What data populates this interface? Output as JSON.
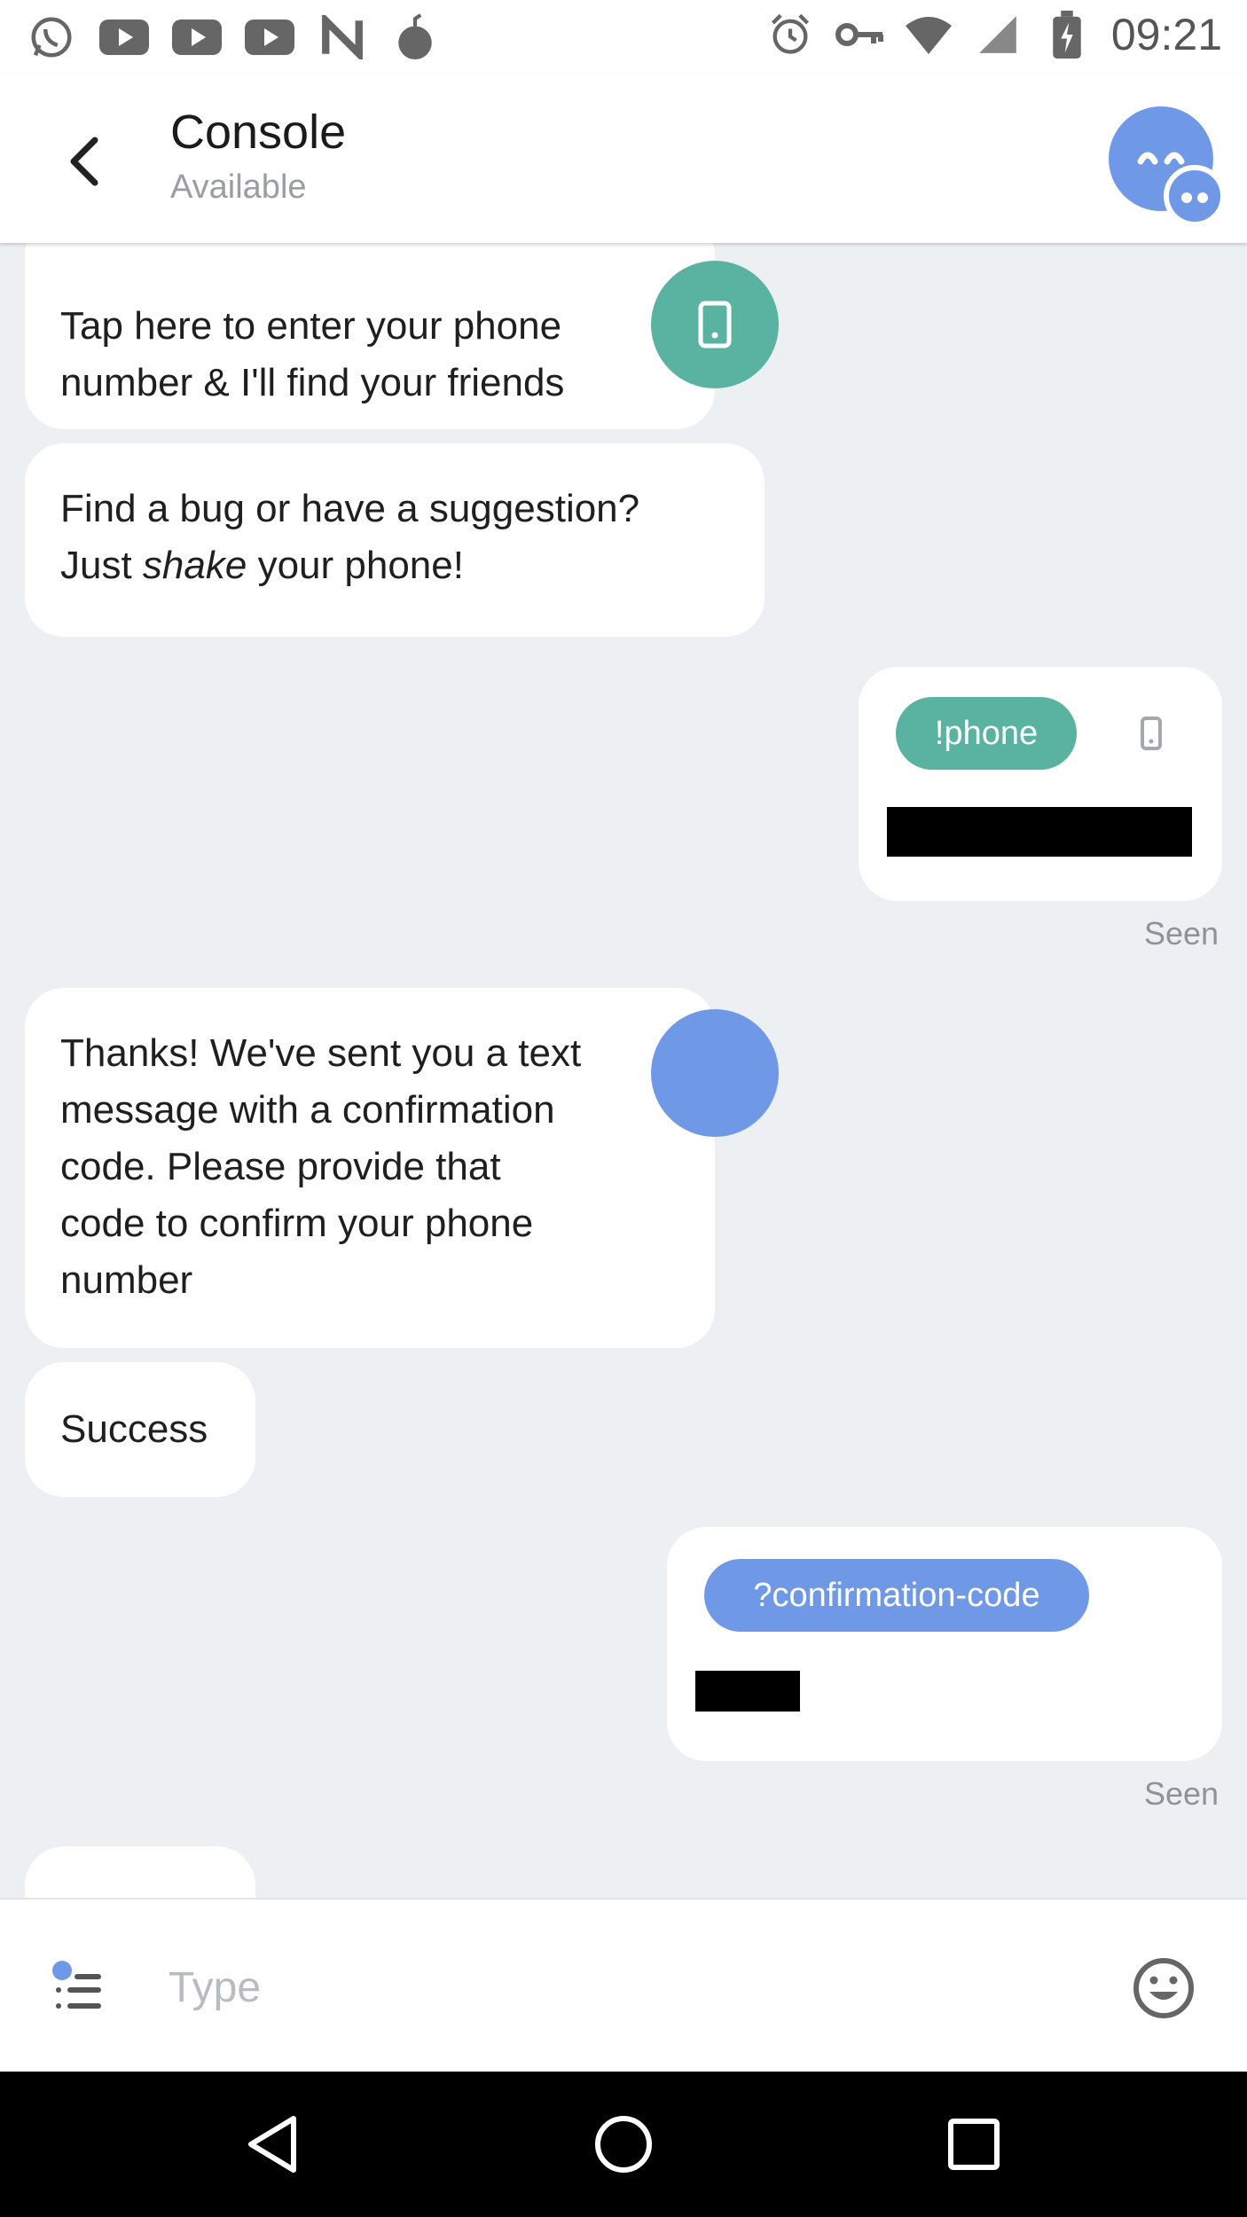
{
  "status_bar": {
    "time": "09:21",
    "left_icons": [
      "whatsapp-icon",
      "youtube-icon",
      "youtube-icon",
      "youtube-icon",
      "n-app-icon",
      "bomb-icon"
    ],
    "right_icons": [
      "alarm-icon",
      "vpn-key-icon",
      "wifi-icon",
      "signal-icon",
      "battery-icon"
    ]
  },
  "header": {
    "title": "Console",
    "subtitle": "Available",
    "avatar_color": "#6f98e6"
  },
  "messages": {
    "m1": {
      "line1": "Tap here to enter your phone",
      "line2": "number & I'll find your friends",
      "icon": "phone-icon",
      "icon_color": "#5ab3a0"
    },
    "m2": {
      "line1": "Find a bug or have a suggestion?",
      "line2_pre": "Just ",
      "line2_em": "shake",
      "line2_post": " your phone!"
    },
    "m3": {
      "chip": "!phone",
      "chip_color": "#5ab3a0",
      "icon": "phone-icon",
      "status": "Seen"
    },
    "m4": {
      "line1": "Thanks! We've sent you a text",
      "line2": "message with a confirmation",
      "line3": "code. Please provide that",
      "line4": "code to confirm your phone",
      "line5": "number"
    },
    "m5": {
      "text": "Success"
    },
    "m6": {
      "chip": "?confirmation-code",
      "chip_color": "#6f98e6",
      "status": "Seen"
    }
  },
  "input": {
    "placeholder": "Type"
  },
  "colors": {
    "accent_teal": "#5ab3a0",
    "accent_blue": "#6f98e6",
    "background": "#edf0f3"
  },
  "nav": {
    "buttons": [
      "back-triangle-icon",
      "home-circle-icon",
      "recents-square-icon"
    ]
  }
}
